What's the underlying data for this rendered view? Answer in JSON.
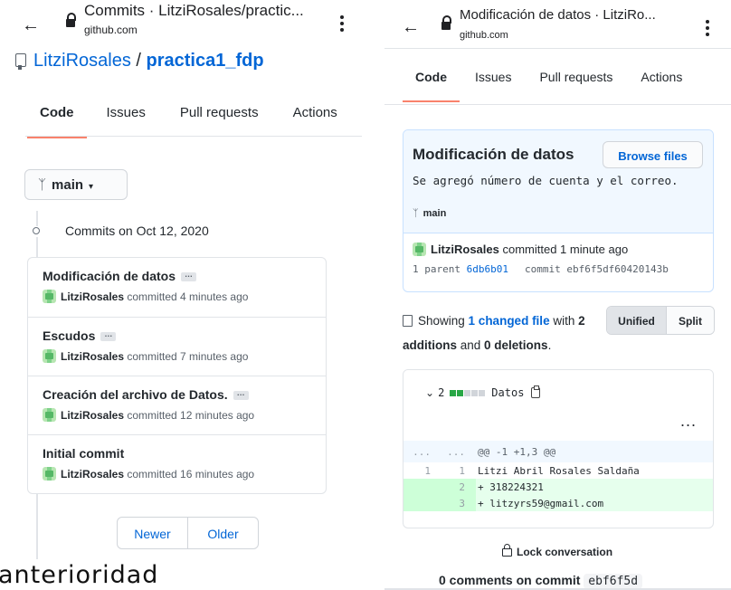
{
  "left": {
    "url_title": "Commits · LitziRosales/practic...",
    "url_host": "github.com",
    "repo_owner": "LitziRosales",
    "repo_sep": " / ",
    "repo_name": "practica1_fdp",
    "tabs": [
      "Code",
      "Issues",
      "Pull requests",
      "Actions"
    ],
    "branch": "main",
    "commits_heading": "Commits on Oct 12, 2020",
    "commits": [
      {
        "title": "Modificación de datos",
        "author": "LitziRosales",
        "time": " committed 4 minutes ago"
      },
      {
        "title": "Escudos",
        "author": "LitziRosales",
        "time": " committed 7 minutes ago"
      },
      {
        "title": "Creación del archivo de Datos.",
        "author": "LitziRosales",
        "time": " committed 12 minutes ago"
      },
      {
        "title": "Initial commit",
        "author": "LitziRosales",
        "time": " committed 16 minutes ago"
      }
    ],
    "pager": {
      "newer": "Newer",
      "older": "Older"
    },
    "caption": "anterioridad"
  },
  "right": {
    "url_title": "Modificación de datos · LitziRo...",
    "url_host": "github.com",
    "tabs": [
      "Code",
      "Issues",
      "Pull requests",
      "Actions"
    ],
    "commit": {
      "title": "Modificación de datos",
      "browse_label": "Browse files",
      "description": "Se agregó número de cuenta y el correo.",
      "branch": "main",
      "author": "LitziRosales",
      "time": " committed 1 minute ago",
      "parent_label": "1 parent ",
      "parent_sha": "6db6b01",
      "commit_label": "commit ",
      "commit_sha": "ebf6f5df60420143b"
    },
    "summary": {
      "prefix": "Showing ",
      "changed": "1 changed file",
      "mid": " with ",
      "additions": "2",
      "line2a": "additions",
      "line2b": " and ",
      "deletions": "0",
      "line2c": " deletions",
      "line2d": ".",
      "unified": "Unified",
      "split": "Split"
    },
    "diff": {
      "changes": "2",
      "file_name": "Datos",
      "more": "...",
      "hunk": {
        "n1": "...",
        "n2": "...",
        "code": "@@ -1 +1,3 @@"
      },
      "lines": [
        {
          "type": "context",
          "n1": "1",
          "n2": "1",
          "code": "  Litzi Abril Rosales Saldaña"
        },
        {
          "type": "add",
          "n1": "",
          "n2": "2",
          "code": "+ 318224321"
        },
        {
          "type": "add",
          "n1": "",
          "n2": "3",
          "code": "+ litzyrs59@gmail.com"
        }
      ]
    },
    "lock_label": "Lock conversation",
    "comments_label": "0 comments on commit ",
    "comments_sha": "ebf6f5d"
  },
  "colors": {
    "link": "#0366d6",
    "tab_underline": "#f9826c",
    "addition_bg": "#e6ffed",
    "commit_box_bg": "#f1f8ff"
  }
}
